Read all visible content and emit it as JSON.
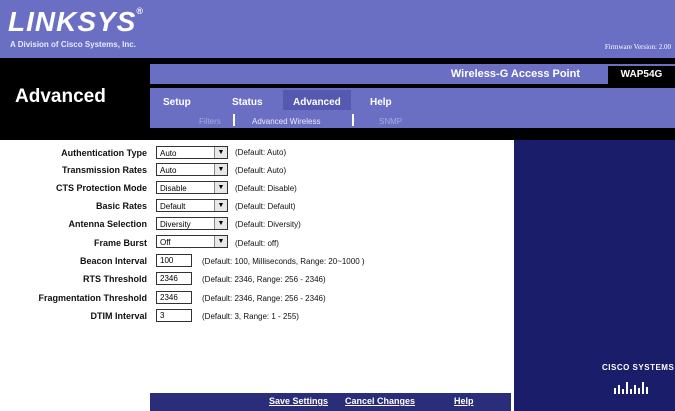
{
  "brand": {
    "name": "LINKSYS",
    "reg": "®",
    "subtitle": "A Division of Cisco Systems, Inc."
  },
  "firmware": "Firmware Version: 2.00",
  "product": {
    "name": "Wireless-G Access Point",
    "model": "WAP54G"
  },
  "page_title": "Advanced",
  "tabs": [
    {
      "label": "Setup"
    },
    {
      "label": "Status"
    },
    {
      "label": "Advanced",
      "active": true
    },
    {
      "label": "Help"
    }
  ],
  "subtabs": [
    {
      "label": "Filters"
    },
    {
      "label": "Advanced Wireless",
      "active": true
    },
    {
      "label": "SNMP"
    }
  ],
  "settings": [
    {
      "label": "Authentication Type",
      "value": "Auto",
      "default": "(Default: Auto)"
    },
    {
      "label": "Transmission Rates",
      "value": "Auto",
      "default": "(Default: Auto)"
    },
    {
      "label": "CTS Protection Mode",
      "value": "Disable",
      "default": "(Default: Disable)"
    },
    {
      "label": "Basic Rates",
      "value": "Default",
      "default": "(Default: Default)"
    },
    {
      "label": "Antenna Selection",
      "value": "Diversity",
      "default": "(Default: Diversity)"
    },
    {
      "label": "Frame Burst",
      "value": "Off",
      "default": "(Default: off)"
    },
    {
      "label": "Beacon Interval",
      "value": "100",
      "default": "(Default: 100, Milliseconds, Range: 20~1000 )"
    },
    {
      "label": "RTS Threshold",
      "value": "2346",
      "default": "(Default: 2346, Range: 256 - 2346)"
    },
    {
      "label": "Fragmentation Threshold",
      "value": "2346",
      "default": "(Default: 2346, Range: 256 - 2346)"
    },
    {
      "label": "DTIM Interval",
      "value": "3",
      "default": "(Default: 3, Range: 1 - 255)"
    }
  ],
  "buttons": {
    "save": "Save Settings",
    "cancel": "Cancel Changes",
    "help": "Help"
  },
  "cisco": "CISCO SYSTEMS",
  "colors": {
    "header": "#6a6fc4",
    "band": "#000000",
    "panel": "#1a1d6a"
  }
}
